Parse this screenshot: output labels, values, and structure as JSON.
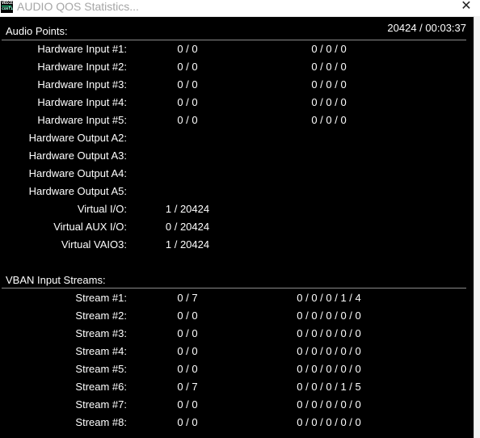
{
  "window": {
    "title": "AUDIO QOS Statistics...",
    "close_glyph": "✕",
    "icon_line1": "VOICE",
    "icon_line2": "config"
  },
  "header": {
    "counter": "20424 / 00:03:37"
  },
  "audio_points": {
    "heading": "Audio Points:",
    "rows": [
      {
        "label": "Hardware Input #1:",
        "v1": "0 / 0",
        "v2": "0 / 0 / 0"
      },
      {
        "label": "Hardware Input #2:",
        "v1": "0 / 0",
        "v2": "0 / 0 / 0"
      },
      {
        "label": "Hardware Input #3:",
        "v1": "0 / 0",
        "v2": "0 / 0 / 0"
      },
      {
        "label": "Hardware Input #4:",
        "v1": "0 / 0",
        "v2": "0 / 0 / 0"
      },
      {
        "label": "Hardware Input #5:",
        "v1": "0 / 0",
        "v2": "0 / 0 / 0"
      },
      {
        "label": "Hardware Output A2:",
        "v1": "",
        "v2": ""
      },
      {
        "label": "Hardware Output A3:",
        "v1": "",
        "v2": ""
      },
      {
        "label": "Hardware Output A4:",
        "v1": "",
        "v2": ""
      },
      {
        "label": "Hardware Output A5:",
        "v1": "",
        "v2": ""
      },
      {
        "label": "Virtual I/O:",
        "v1": "1 / 20424",
        "v2": ""
      },
      {
        "label": "Virtual AUX I/O:",
        "v1": "0 / 20424",
        "v2": ""
      },
      {
        "label": "Virtual VAIO3:",
        "v1": "1 / 20424",
        "v2": ""
      }
    ]
  },
  "vban_streams": {
    "heading": "VBAN Input Streams:",
    "rows": [
      {
        "label": "Stream #1:",
        "v1": "0 / 7",
        "v2": "0 / 0 / 0 / 1 / 4"
      },
      {
        "label": "Stream #2:",
        "v1": "0 / 0",
        "v2": "0 / 0 / 0 / 0 / 0"
      },
      {
        "label": "Stream #3:",
        "v1": "0 / 0",
        "v2": "0 / 0 / 0 / 0 / 0"
      },
      {
        "label": "Stream #4:",
        "v1": "0 / 0",
        "v2": "0 / 0 / 0 / 0 / 0"
      },
      {
        "label": "Stream #5:",
        "v1": "0 / 0",
        "v2": "0 / 0 / 0 / 0 / 0"
      },
      {
        "label": "Stream #6:",
        "v1": "0 / 7",
        "v2": "0 / 0 / 0 / 1 / 5"
      },
      {
        "label": "Stream #7:",
        "v1": "0 / 0",
        "v2": "0 / 0 / 0 / 0 / 0"
      },
      {
        "label": "Stream #8:",
        "v1": "0 / 0",
        "v2": "0 / 0 / 0 / 0 / 0"
      }
    ]
  }
}
